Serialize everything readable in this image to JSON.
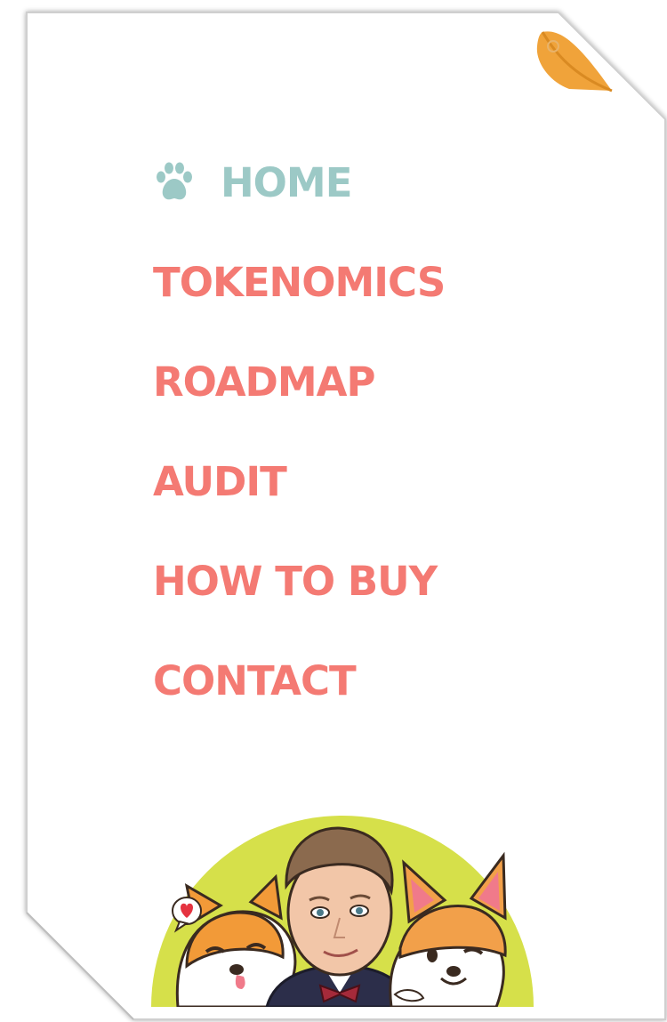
{
  "nav": {
    "items": [
      {
        "label": "HOME",
        "active": true
      },
      {
        "label": "TOKENOMICS",
        "active": false
      },
      {
        "label": "ROADMAP",
        "active": false
      },
      {
        "label": "AUDIT",
        "active": false
      },
      {
        "label": "HOW TO BUY",
        "active": false
      },
      {
        "label": "CONTACT",
        "active": false
      }
    ]
  },
  "colors": {
    "active": "#9cc9c6",
    "link": "#f47a73",
    "accent_orange": "#f0a33a",
    "illustration_bg": "#d6e04a"
  },
  "icons": {
    "home": "paw-icon",
    "corner": "folded-corner-icon",
    "bubble": "heart-bubble-icon"
  }
}
